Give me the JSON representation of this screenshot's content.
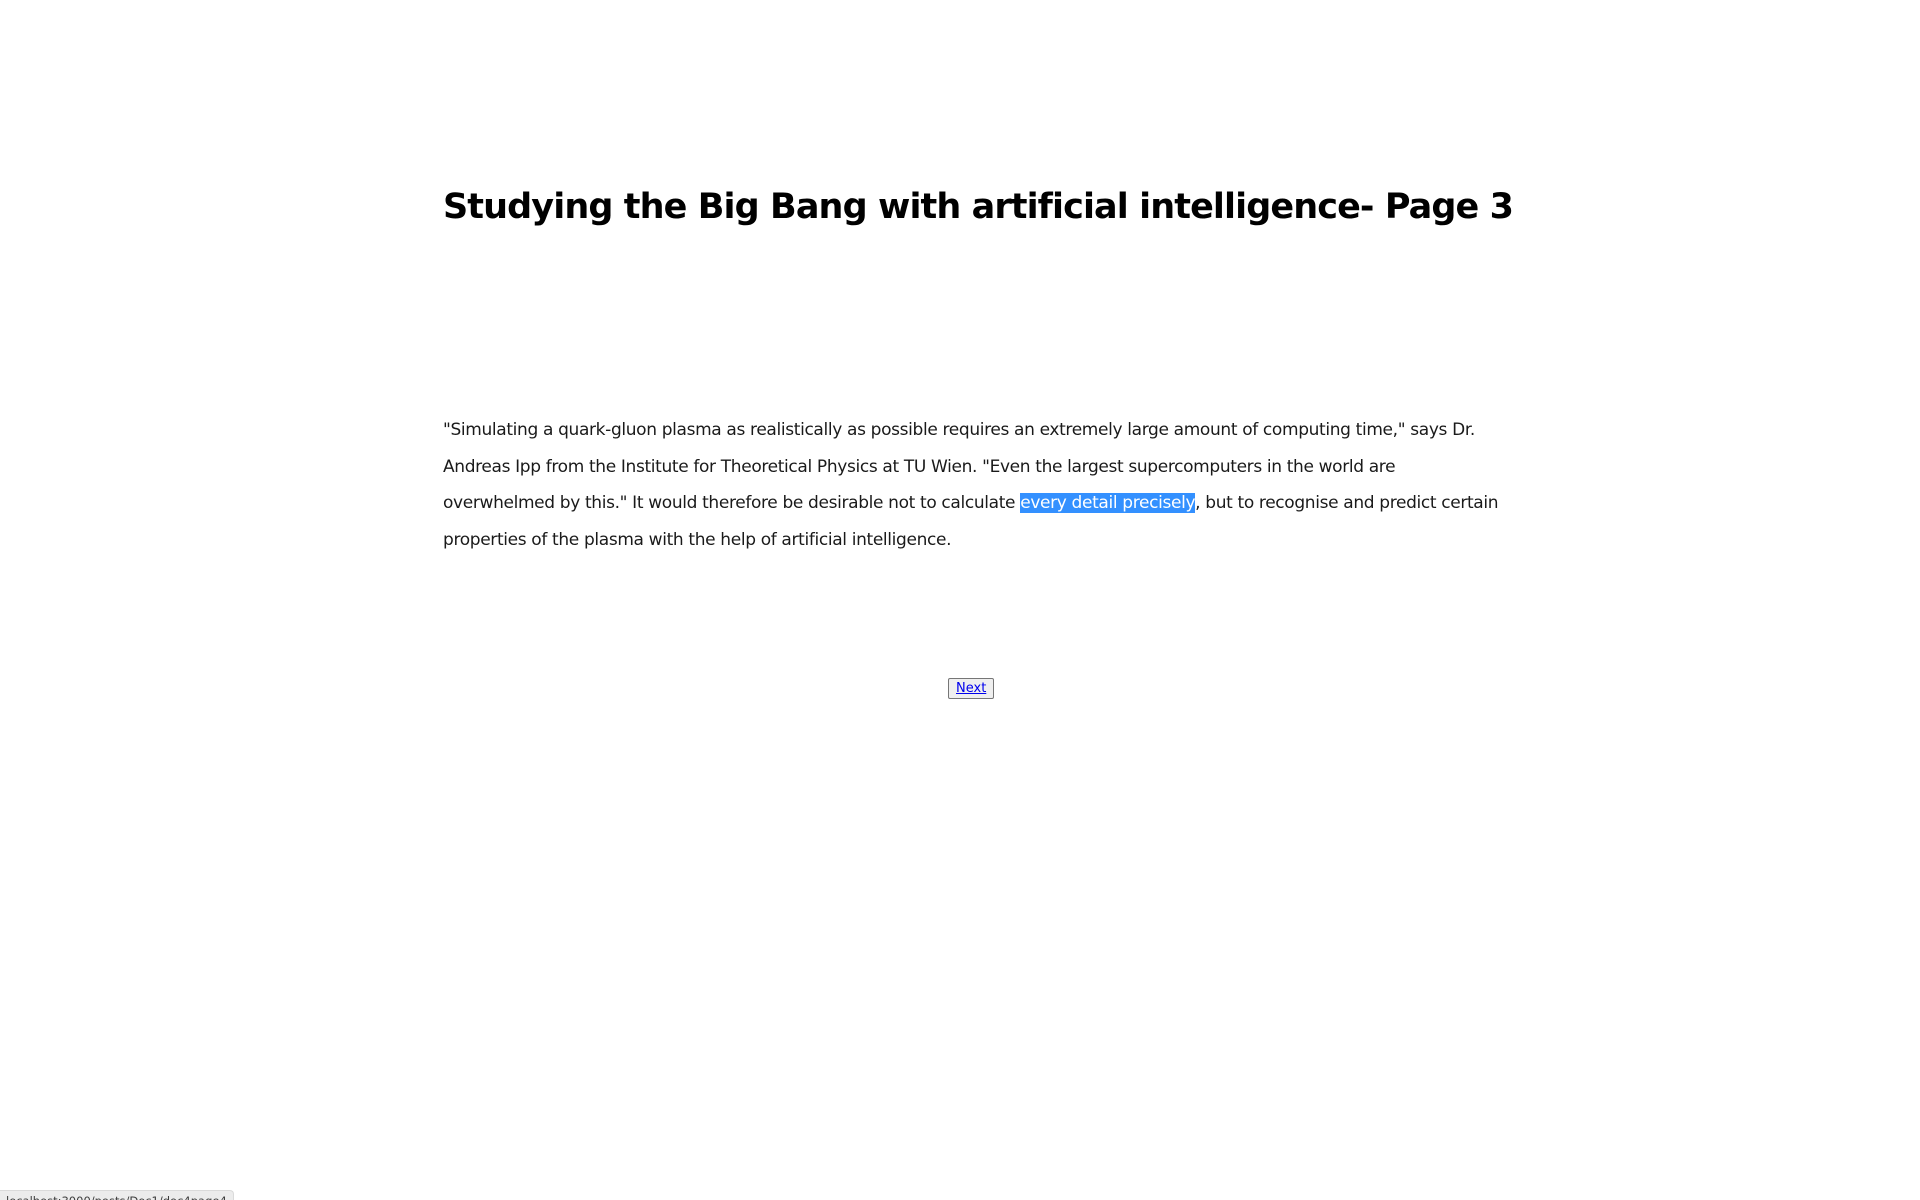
{
  "page": {
    "title": "Studying the Big Bang with artificial intelligence- Page 3"
  },
  "article": {
    "text_before_selection": "\"Simulating a quark-gluon plasma as realistically as possible requires an extremely large amount of computing time,\" says Dr. Andreas Ipp from the Institute for Theoretical Physics at TU Wien. \"Even the largest supercomputers in the world are overwhelmed by this.\" It would therefore be desirable not to calculate ",
    "selected_text": "every detail precisely",
    "text_after_selection": ", but to recognise and predict certain properties of the plasma with the help of artificial intelligence."
  },
  "navigation": {
    "next_label": "Next"
  },
  "status_bar": {
    "url": "localhost:3000/posts/Doc1/doc4page4"
  },
  "colors": {
    "selection_background": "#3390ff",
    "selection_text": "#ffffff",
    "link": "#0000ee",
    "background": "#ffffff"
  }
}
